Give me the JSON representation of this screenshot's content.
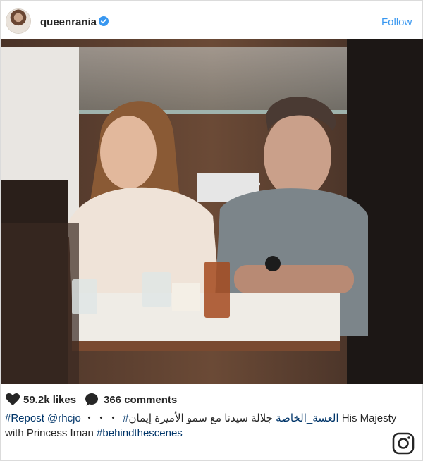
{
  "post": {
    "username": "queenrania",
    "follow_label": "Follow",
    "likes": "59.2k likes",
    "comments": "366 comments",
    "caption": {
      "repost_tag": "#Repost",
      "mention": "@rhcjo",
      "dots": "・・・",
      "hashtag_ar": "#العسة_الخاصة",
      "arabic_text": "جلالة سيدنا مع سمو الأميرة إيمان",
      "english_text": "His Majesty with Princess Iman",
      "hashtag_en": "#behindthescenes"
    }
  },
  "colors": {
    "link_blue": "#3897f0",
    "tag_blue": "#003569",
    "verified_blue": "#3897f0",
    "border": "#dbdbdb"
  },
  "icons": {
    "heart": "heart-icon",
    "comment": "comment-bubble-icon",
    "verified": "verified-badge-icon",
    "logo": "instagram-logo-icon"
  }
}
